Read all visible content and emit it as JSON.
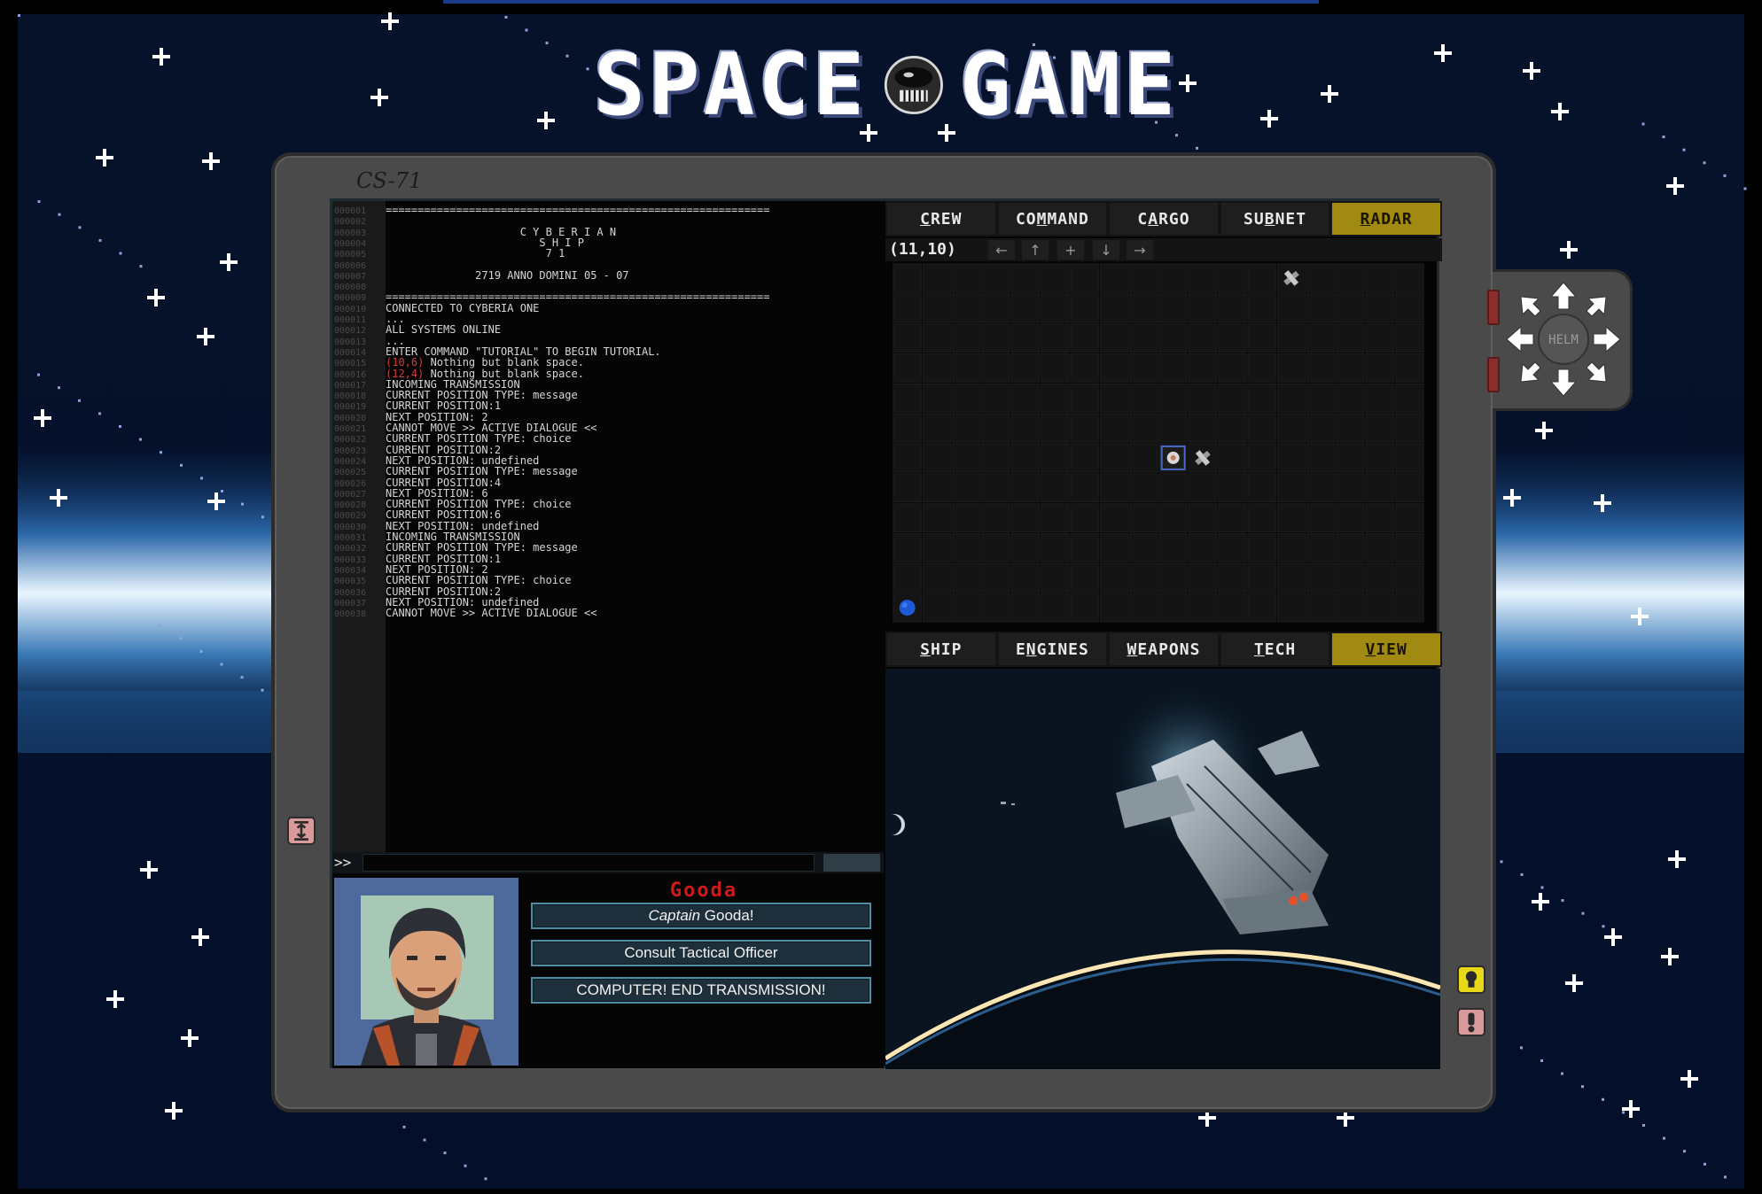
{
  "logo": {
    "word_left": "SPACE",
    "word_right": "GAME"
  },
  "console": {
    "id": "CS-71"
  },
  "terminal": {
    "prompt": ">>",
    "lines": [
      {
        "n": "000001",
        "pre": "============================================================",
        "coord": "",
        "post": ""
      },
      {
        "n": "000002",
        "pre": "",
        "coord": "",
        "post": ""
      },
      {
        "n": "000003",
        "pre": "                     C Y B E R I A N",
        "coord": "",
        "post": ""
      },
      {
        "n": "000004",
        "pre": "                        S H I P",
        "coord": "",
        "post": ""
      },
      {
        "n": "000005",
        "pre": "                         7 1",
        "coord": "",
        "post": ""
      },
      {
        "n": "000006",
        "pre": "",
        "coord": "",
        "post": ""
      },
      {
        "n": "000007",
        "pre": "              2719 ANNO DOMINI 05 - 07",
        "coord": "",
        "post": ""
      },
      {
        "n": "000008",
        "pre": "",
        "coord": "",
        "post": ""
      },
      {
        "n": "000009",
        "pre": "============================================================",
        "coord": "",
        "post": ""
      },
      {
        "n": "000010",
        "pre": "CONNECTED TO CYBERIA ONE",
        "coord": "",
        "post": ""
      },
      {
        "n": "000011",
        "pre": "...",
        "coord": "",
        "post": ""
      },
      {
        "n": "000012",
        "pre": "ALL SYSTEMS ONLINE",
        "coord": "",
        "post": ""
      },
      {
        "n": "000013",
        "pre": "...",
        "coord": "",
        "post": ""
      },
      {
        "n": "000014",
        "pre": "ENTER COMMAND \"TUTORIAL\" TO BEGIN TUTORIAL.",
        "coord": "",
        "post": ""
      },
      {
        "n": "000015",
        "pre": "",
        "coord": "(10,6)",
        "post": " Nothing but blank space."
      },
      {
        "n": "000016",
        "pre": "",
        "coord": "(12,4)",
        "post": " Nothing but blank space."
      },
      {
        "n": "000017",
        "pre": "INCOMING TRANSMISSION",
        "coord": "",
        "post": ""
      },
      {
        "n": "000018",
        "pre": "CURRENT POSITION TYPE: message",
        "coord": "",
        "post": ""
      },
      {
        "n": "000019",
        "pre": "CURRENT POSITION:1",
        "coord": "",
        "post": ""
      },
      {
        "n": "000020",
        "pre": "NEXT POSITION: 2",
        "coord": "",
        "post": ""
      },
      {
        "n": "000021",
        "pre": "CANNOT MOVE >> ACTIVE DIALOGUE <<",
        "coord": "",
        "post": ""
      },
      {
        "n": "000022",
        "pre": "CURRENT POSITION TYPE: choice",
        "coord": "",
        "post": ""
      },
      {
        "n": "000023",
        "pre": "CURRENT POSITION:2",
        "coord": "",
        "post": ""
      },
      {
        "n": "000024",
        "pre": "NEXT POSITION: undefined",
        "coord": "",
        "post": ""
      },
      {
        "n": "000025",
        "pre": "CURRENT POSITION TYPE: message",
        "coord": "",
        "post": ""
      },
      {
        "n": "000026",
        "pre": "CURRENT POSITION:4",
        "coord": "",
        "post": ""
      },
      {
        "n": "000027",
        "pre": "NEXT POSITION: 6",
        "coord": "",
        "post": ""
      },
      {
        "n": "000028",
        "pre": "CURRENT POSITION TYPE: choice",
        "coord": "",
        "post": ""
      },
      {
        "n": "000029",
        "pre": "CURRENT POSITION:6",
        "coord": "",
        "post": ""
      },
      {
        "n": "000030",
        "pre": "NEXT POSITION: undefined",
        "coord": "",
        "post": ""
      },
      {
        "n": "000031",
        "pre": "INCOMING TRANSMISSION",
        "coord": "",
        "post": ""
      },
      {
        "n": "000032",
        "pre": "CURRENT POSITION TYPE: message",
        "coord": "",
        "post": ""
      },
      {
        "n": "000033",
        "pre": "CURRENT POSITION:1",
        "coord": "",
        "post": ""
      },
      {
        "n": "000034",
        "pre": "NEXT POSITION: 2",
        "coord": "",
        "post": ""
      },
      {
        "n": "000035",
        "pre": "CURRENT POSITION TYPE: choice",
        "coord": "",
        "post": ""
      },
      {
        "n": "000036",
        "pre": "CURRENT POSITION:2",
        "coord": "",
        "post": ""
      },
      {
        "n": "000037",
        "pre": "NEXT POSITION: undefined",
        "coord": "",
        "post": ""
      },
      {
        "n": "000038",
        "pre": "CANNOT MOVE >> ACTIVE DIALOGUE <<",
        "coord": "",
        "post": ""
      }
    ]
  },
  "dialogue": {
    "speaker": "Gooda",
    "choices": [
      {
        "em": "Captain",
        "text": " Gooda!"
      },
      {
        "em": "",
        "text": "Consult Tactical Officer"
      },
      {
        "em": "",
        "text": "COMPUTER! END TRANSMISSION!"
      }
    ]
  },
  "top_tabs": [
    {
      "pre": "",
      "key": "C",
      "post": "REW",
      "active": false
    },
    {
      "pre": "CO",
      "key": "M",
      "post": "MAND",
      "active": false
    },
    {
      "pre": "C",
      "key": "A",
      "post": "RGO",
      "active": false
    },
    {
      "pre": "SU",
      "key": "B",
      "post": "NET",
      "active": false
    },
    {
      "pre": "",
      "key": "R",
      "post": "ADAR",
      "active": true
    }
  ],
  "bottom_tabs": [
    {
      "pre": "",
      "key": "S",
      "post": "HIP",
      "active": false
    },
    {
      "pre": "E",
      "key": "N",
      "post": "GINES",
      "active": false
    },
    {
      "pre": "",
      "key": "W",
      "post": "EAPONS",
      "active": false
    },
    {
      "pre": "",
      "key": "T",
      "post": "ECH",
      "active": false
    },
    {
      "pre": "",
      "key": "V",
      "post": "IEW",
      "active": true
    }
  ],
  "radar": {
    "coords": "(11,10)",
    "nav": [
      "←",
      "↑",
      "+",
      "↓",
      "→"
    ],
    "grid": {
      "cols": 18,
      "rows": 12
    },
    "objects": [
      {
        "kind": "satellite",
        "col": 13,
        "row": 0
      },
      {
        "kind": "player-ship",
        "col": 9,
        "row": 6
      },
      {
        "kind": "satellite",
        "col": 10,
        "row": 6
      },
      {
        "kind": "planet",
        "col": 0,
        "row": 11
      }
    ]
  },
  "helm": {
    "label": "HELM"
  },
  "colors": {
    "accent": "#a08a12",
    "console": "#4a4a4a",
    "alert": "#cc1a1a",
    "hint_button": "#e8d81a",
    "warn_button": "#d89a9a",
    "toggle_button": "#d89a9a"
  }
}
